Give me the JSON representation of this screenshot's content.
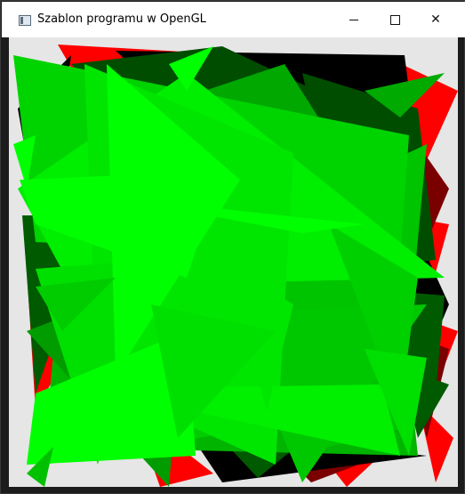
{
  "window": {
    "title": "Szablon programu w OpenGL",
    "controls": {
      "minimize_icon": "minimize-icon",
      "maximize_icon": "maximize-icon",
      "close_icon": "close-icon",
      "close_glyph": "✕"
    }
  },
  "canvas": {
    "description_colors": {
      "background": "#e6e6e6",
      "bright_green": "#00ff00",
      "mid_green": "#00c400",
      "dark_green": "#004d00",
      "black": "#000000",
      "red": "#ff0000",
      "dark_red": "#7a0000"
    }
  }
}
